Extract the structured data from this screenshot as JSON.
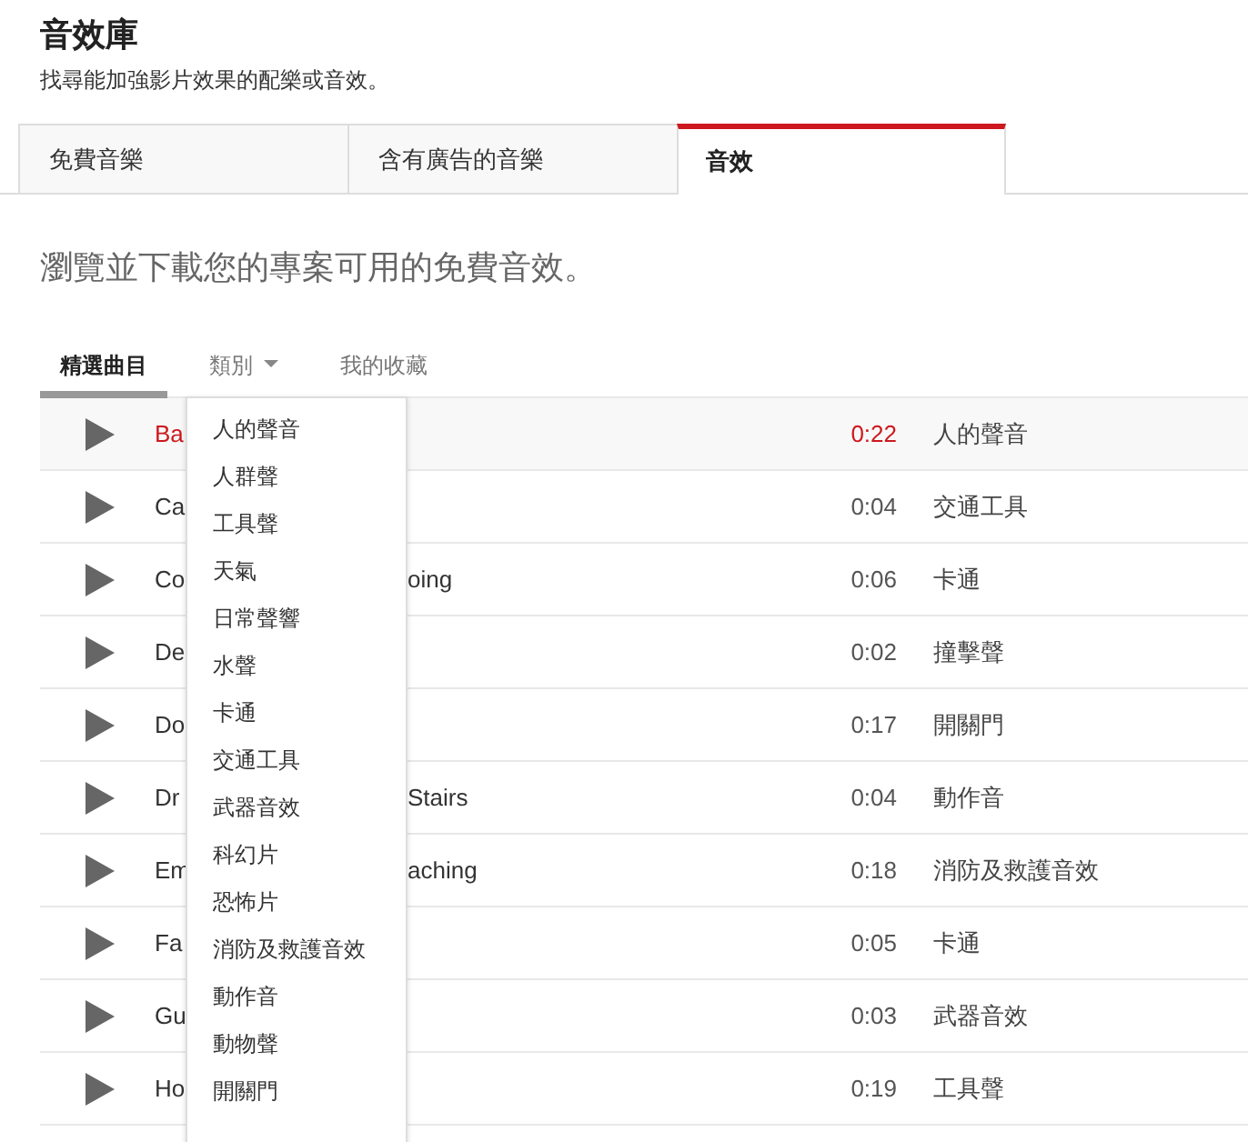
{
  "header": {
    "title": "音效庫",
    "subtitle": "找尋能加強影片效果的配樂或音效。"
  },
  "tabs": [
    {
      "label": "免費音樂",
      "selected": false
    },
    {
      "label": "含有廣告的音樂",
      "selected": false
    },
    {
      "label": "音效",
      "selected": true
    }
  ],
  "heading": "瀏覽並下載您的專案可用的免費音效。",
  "filters": [
    {
      "label": "精選曲目",
      "selected": true,
      "kind": "tab"
    },
    {
      "label": "類別",
      "selected": false,
      "kind": "dropdown"
    },
    {
      "label": "我的收藏",
      "selected": false,
      "kind": "tab"
    }
  ],
  "category_menu": [
    "人的聲音",
    "人群聲",
    "工具聲",
    "天氣",
    "日常聲響",
    "水聲",
    "卡通",
    "交通工具",
    "武器音效",
    "科幻片",
    "恐怖片",
    "消防及救護音效",
    "動作音",
    "動物聲",
    "開關門"
  ],
  "tracks": [
    {
      "title_start": "Ba",
      "duration": "0:22",
      "category": "人的聲音",
      "selected": true
    },
    {
      "title_start": "Ca",
      "duration": "0:04",
      "category": "交通工具",
      "selected": false
    },
    {
      "title_start": "Co",
      "title_end": "oing",
      "duration": "0:06",
      "category": "卡通",
      "selected": false
    },
    {
      "title_start": "De",
      "duration": "0:02",
      "category": "撞擊聲",
      "selected": false
    },
    {
      "title_start": "Do",
      "duration": "0:17",
      "category": "開關門",
      "selected": false
    },
    {
      "title_start": "Dr",
      "title_end": "Stairs",
      "duration": "0:04",
      "category": "動作音",
      "selected": false
    },
    {
      "title_start": "Em",
      "title_end": "aching",
      "duration": "0:18",
      "category": "消防及救護音效",
      "selected": false
    },
    {
      "title_start": "Fa",
      "duration": "0:05",
      "category": "卡通",
      "selected": false
    },
    {
      "title_start": "Gu",
      "duration": "0:03",
      "category": "武器音效",
      "selected": false
    },
    {
      "title_start": "Ho",
      "duration": "0:19",
      "category": "工具聲",
      "selected": false
    }
  ]
}
